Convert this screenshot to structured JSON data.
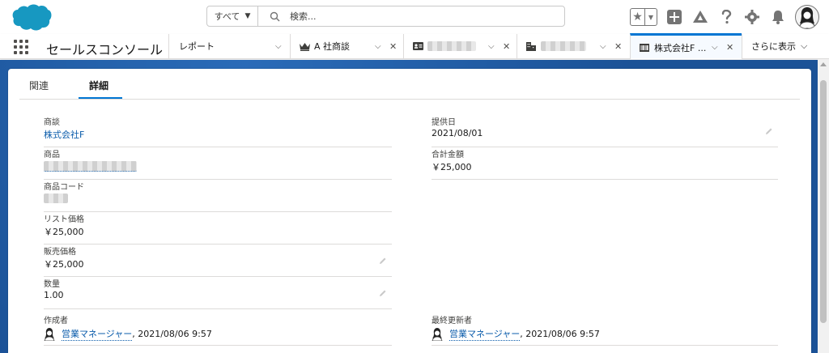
{
  "header": {
    "search_scope": "すべて",
    "search_placeholder": "検索...",
    "colors": {
      "brand": "#1798c1",
      "accent": "#0176d3",
      "link": "#0b5cab"
    }
  },
  "tabbar": {
    "app_name": "セールスコンソール",
    "tabs": [
      {
        "label": "レポート"
      },
      {
        "label": "A 社商談",
        "icon": "crown-icon"
      },
      {
        "label": "",
        "icon": "contact-card-icon"
      },
      {
        "label": "",
        "icon": "account-building-icon"
      },
      {
        "label": "株式会社F ...",
        "icon": "product-icon",
        "active": true
      }
    ],
    "more_label": "さらに表示"
  },
  "record": {
    "tabs": {
      "related": "関連",
      "details": "詳細"
    },
    "fields": {
      "opportunity": {
        "label": "商談",
        "value": "株式会社F"
      },
      "product": {
        "label": "商品",
        "value": ""
      },
      "product_code": {
        "label": "商品コード",
        "value": ""
      },
      "list_price": {
        "label": "リスト価格",
        "value": "￥25,000"
      },
      "sales_price": {
        "label": "販売価格",
        "value": "￥25,000"
      },
      "quantity": {
        "label": "数量",
        "value": "1.00"
      },
      "created_by": {
        "label": "作成者",
        "user": "営業マネージャー",
        "timestamp": ", 2021/08/06 9:57"
      },
      "service_date": {
        "label": "提供日",
        "value": "2021/08/01"
      },
      "total_price": {
        "label": "合計金額",
        "value": "￥25,000"
      },
      "last_modified_by": {
        "label": "最終更新者",
        "user": "営業マネージャー",
        "timestamp": ", 2021/08/06 9:57"
      }
    }
  }
}
